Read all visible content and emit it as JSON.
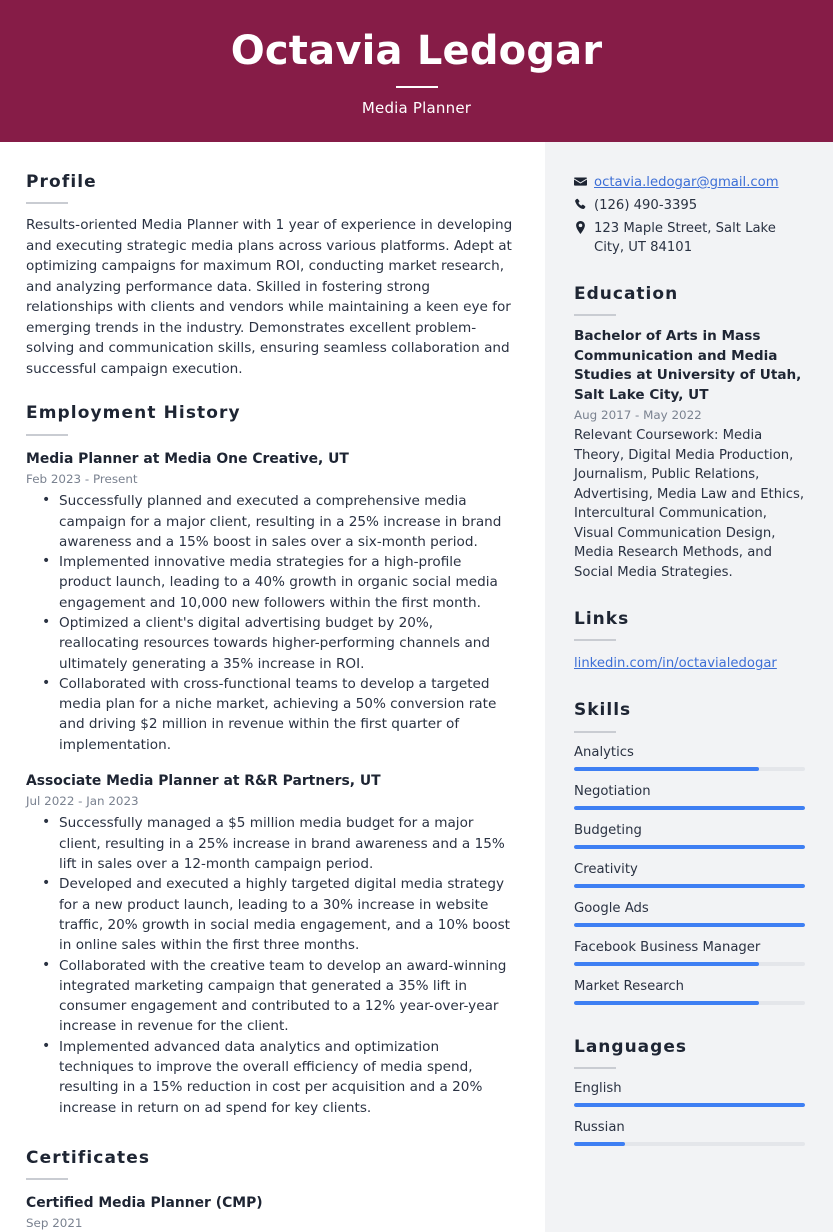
{
  "header": {
    "name": "Octavia Ledogar",
    "title": "Media Planner",
    "bg_color": "#861C47"
  },
  "main": {
    "profile": {
      "heading": "Profile",
      "text": "Results-oriented Media Planner with 1 year of experience in developing and executing strategic media plans across various platforms. Adept at optimizing campaigns for maximum ROI, conducting market research, and analyzing performance data. Skilled in fostering strong relationships with clients and vendors while maintaining a keen eye for emerging trends in the industry. Demonstrates excellent problem-solving and communication skills, ensuring seamless collaboration and successful campaign execution."
    },
    "employment": {
      "heading": "Employment History",
      "jobs": [
        {
          "title": "Media Planner at Media One Creative, UT",
          "date": "Feb 2023 - Present",
          "bullets": [
            "Successfully planned and executed a comprehensive media campaign for a major client, resulting in a 25% increase in brand awareness and a 15% boost in sales over a six-month period.",
            "Implemented innovative media strategies for a high-profile product launch, leading to a 40% growth in organic social media engagement and 10,000 new followers within the first month.",
            "Optimized a client's digital advertising budget by 20%, reallocating resources towards higher-performing channels and ultimately generating a 35% increase in ROI.",
            "Collaborated with cross-functional teams to develop a targeted media plan for a niche market, achieving a 50% conversion rate and driving $2 million in revenue within the first quarter of implementation."
          ]
        },
        {
          "title": "Associate Media Planner at R&R Partners, UT",
          "date": "Jul 2022 - Jan 2023",
          "bullets": [
            "Successfully managed a $5 million media budget for a major client, resulting in a 25% increase in brand awareness and a 15% lift in sales over a 12-month campaign period.",
            "Developed and executed a highly targeted digital media strategy for a new product launch, leading to a 30% increase in website traffic, 20% growth in social media engagement, and a 10% boost in online sales within the first three months.",
            "Collaborated with the creative team to develop an award-winning integrated marketing campaign that generated a 35% lift in consumer engagement and contributed to a 12% year-over-year increase in revenue for the client.",
            "Implemented advanced data analytics and optimization techniques to improve the overall efficiency of media spend, resulting in a 15% reduction in cost per acquisition and a 20% increase in return on ad spend for key clients."
          ]
        }
      ]
    },
    "certificates": {
      "heading": "Certificates",
      "items": [
        {
          "title": "Certified Media Planner (CMP)",
          "date": "Sep 2021"
        }
      ]
    }
  },
  "sidebar": {
    "contact": [
      {
        "icon": "envelope-icon",
        "text": "octavia.ledogar@gmail.com",
        "is_link": true
      },
      {
        "icon": "phone-icon",
        "text": "(126) 490-3395",
        "is_link": false
      },
      {
        "icon": "location-pin-icon",
        "text": "123 Maple Street, Salt Lake City, UT 84101",
        "is_link": false
      }
    ],
    "education": {
      "heading": "Education",
      "degree": "Bachelor of Arts in Mass Communication and Media Studies at University of Utah, Salt Lake City, UT",
      "date": "Aug 2017 - May 2022",
      "description": "Relevant Coursework: Media Theory, Digital Media Production, Journalism, Public Relations, Advertising, Media Law and Ethics, Intercultural Communication, Visual Communication Design, Media Research Methods, and Social Media Strategies."
    },
    "links": {
      "heading": "Links",
      "items": [
        {
          "label": "linkedin.com/in/octavialedogar"
        }
      ]
    },
    "skills": {
      "heading": "Skills",
      "items": [
        {
          "label": "Analytics",
          "level": 80
        },
        {
          "label": "Negotiation",
          "level": 100
        },
        {
          "label": "Budgeting",
          "level": 100
        },
        {
          "label": "Creativity",
          "level": 100
        },
        {
          "label": "Google Ads",
          "level": 100
        },
        {
          "label": "Facebook Business Manager",
          "level": 80
        },
        {
          "label": "Market Research",
          "level": 80
        }
      ]
    },
    "languages": {
      "heading": "Languages",
      "items": [
        {
          "label": "English",
          "level": 100
        },
        {
          "label": "Russian",
          "level": 22
        }
      ]
    },
    "accent_color": "#3E7FF3",
    "track_color": "#E4E6EA",
    "bg_color": "#F2F3F5"
  }
}
